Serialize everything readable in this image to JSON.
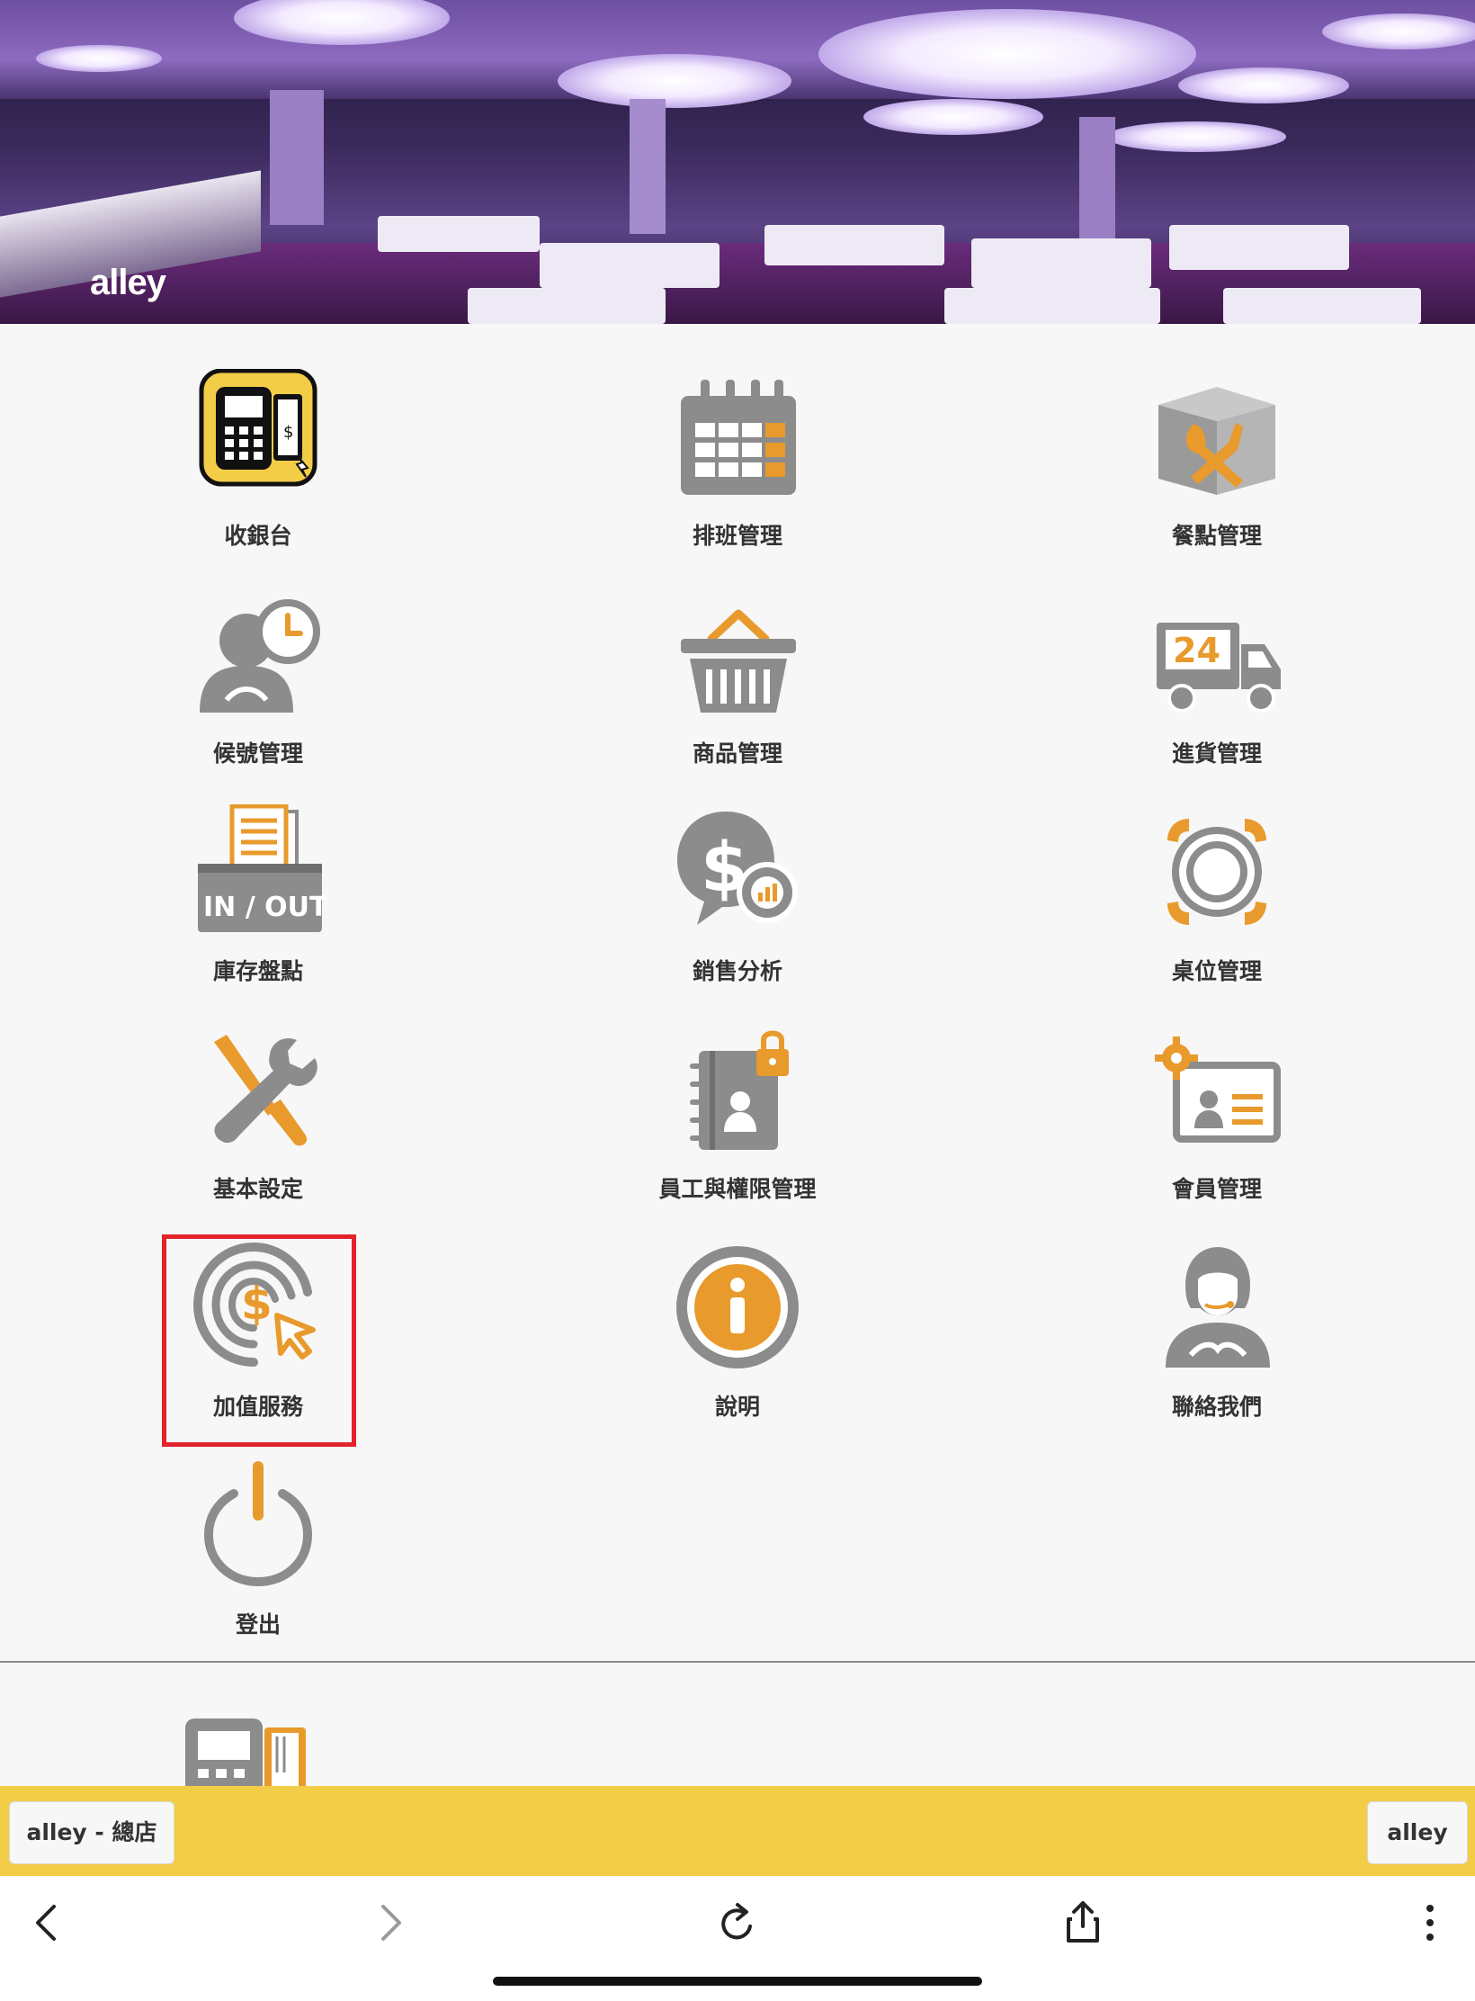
{
  "banner": {
    "logo_text": "alley"
  },
  "menu": {
    "items": [
      {
        "label": "收銀台",
        "icon": "cash-register-icon"
      },
      {
        "label": "排班管理",
        "icon": "calendar-icon"
      },
      {
        "label": "餐點管理",
        "icon": "menu-book-icon"
      },
      {
        "label": "候號管理",
        "icon": "queue-person-clock-icon"
      },
      {
        "label": "商品管理",
        "icon": "basket-icon"
      },
      {
        "label": "進貨管理",
        "icon": "truck-24-icon"
      },
      {
        "label": "庫存盤點",
        "icon": "inventory-inout-icon",
        "icon_text": "IN / OUT"
      },
      {
        "label": "銷售分析",
        "icon": "sales-analysis-icon"
      },
      {
        "label": "桌位管理",
        "icon": "table-plate-icon"
      },
      {
        "label": "基本設定",
        "icon": "tools-icon"
      },
      {
        "label": "員工與權限管理",
        "icon": "staff-lock-icon"
      },
      {
        "label": "會員管理",
        "icon": "member-card-icon"
      },
      {
        "label": "加值服務",
        "icon": "value-added-icon"
      },
      {
        "label": "說明",
        "icon": "info-icon"
      },
      {
        "label": "聯絡我們",
        "icon": "support-agent-icon"
      },
      {
        "label": "登出",
        "icon": "power-icon"
      }
    ],
    "truck_text": "24"
  },
  "store_bar": {
    "store_label": "alley - 總店",
    "user_label": "alley"
  },
  "colors": {
    "accent": "#f4cd48",
    "orange": "#e89a2c",
    "gray": "#8c8c8c",
    "highlight": "#e3232b"
  }
}
